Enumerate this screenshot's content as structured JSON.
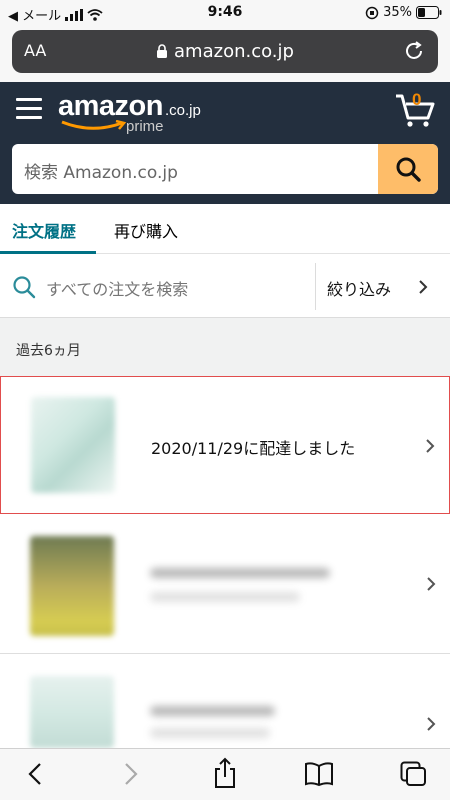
{
  "status_bar": {
    "carrier": "◀ メール",
    "time": "9:46",
    "battery": "35%"
  },
  "browser": {
    "aa_label": "AA",
    "url": "amazon.co.jp"
  },
  "header": {
    "logo_word": "amazon",
    "logo_tld": ".co.jp",
    "logo_sub": "prime",
    "cart_count": "0",
    "search_placeholder": "検索 Amazon.co.jp"
  },
  "tabs": [
    {
      "label": "注文履歴",
      "active": true
    },
    {
      "label": "再び購入",
      "active": false
    }
  ],
  "order_search": {
    "placeholder": "すべての注文を検索",
    "filter_label": "絞り込み"
  },
  "section_label": "過去6ヵ月",
  "orders": [
    {
      "title": "2020/11/29に配達しました"
    }
  ],
  "colors": {
    "header_bg": "#232f3e",
    "accent": "#007185",
    "search_button": "#febd69",
    "cart_count": "#f08804"
  }
}
